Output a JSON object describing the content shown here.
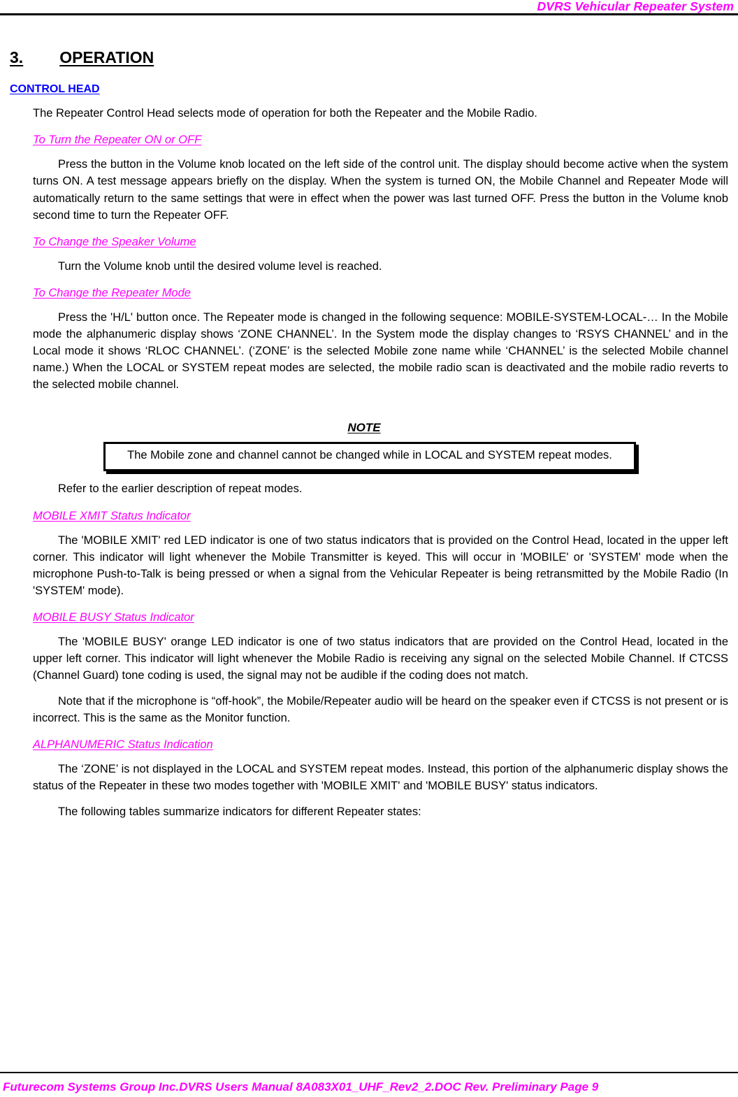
{
  "document": {
    "header_title": "DVRS Vehicular Repeater System",
    "footer_text": "Futurecom Systems Group Inc.DVRS Users Manual 8A083X01_UHF_Rev2_2.DOC Rev. Preliminary  Page 9",
    "colors": {
      "accent_magenta": "#FF00FF",
      "heading_blue": "#0000FF",
      "text_black": "#000000",
      "page_background": "#FFFFFF"
    }
  },
  "section": {
    "number": "3.",
    "title": "OPERATION"
  },
  "control_head": {
    "heading": "CONTROL HEAD",
    "intro": "The Repeater Control Head selects mode of operation for both the Repeater and the Mobile Radio.",
    "subsections": [
      {
        "heading": "To Turn the Repeater ON or OFF",
        "body": "Press the button in the Volume knob located on the left side of the control unit. The display should become active when the system turns ON. A test message appears briefly on the display. When the system is turned ON, the Mobile Channel and Repeater Mode will automatically return to the same settings that were in effect when the power was last turned OFF. Press the button in the Volume knob second time to turn the Repeater OFF."
      },
      {
        "heading": "To Change the Speaker Volume",
        "body": "Turn the Volume knob until the desired volume level is reached."
      },
      {
        "heading": "To Change the Repeater Mode",
        "body": "Press the 'H/L' button once. The Repeater mode is changed in the following sequence: MOBILE-SYSTEM-LOCAL-… In the Mobile mode the alphanumeric display shows ‘ZONE CHANNEL’. In the System mode the display changes to ‘RSYS CHANNEL’ and in the Local mode it shows ‘RLOC CHANNEL’. (‘ZONE’ is the selected Mobile zone name while ‘CHANNEL’ is the selected Mobile channel name.) When the LOCAL or SYSTEM repeat modes are selected, the mobile radio scan is deactivated and the mobile radio reverts to the selected mobile channel."
      }
    ]
  },
  "note": {
    "label": "NOTE",
    "text": "The Mobile zone and channel cannot be changed while in LOCAL and SYSTEM repeat modes."
  },
  "after_note": {
    "refer_text": "Refer to the earlier description of repeat modes."
  },
  "indicators": [
    {
      "heading": "MOBILE XMIT Status Indicator",
      "paragraphs": [
        "The 'MOBILE XMIT' red LED indicator is one of two status indicators that is provided on the Control Head, located in the upper left corner. This indicator will light whenever the Mobile Transmitter is keyed. This will occur in 'MOBILE' or 'SYSTEM' mode when the microphone Push-to-Talk is being pressed or when a signal from the Vehicular Repeater is being retransmitted by the Mobile Radio (In 'SYSTEM' mode)."
      ]
    },
    {
      "heading": "MOBILE BUSY Status Indicator",
      "paragraphs": [
        "The 'MOBILE BUSY' orange LED indicator is one of two status indicators that are provided on the Control Head, located in the upper left corner. This indicator will light whenever the Mobile Radio is receiving any signal on the selected Mobile Channel. If CTCSS (Channel Guard) tone coding is used, the signal may not be audible if the coding does not match.",
        "Note that if the microphone is “off-hook”, the Mobile/Repeater audio will be heard on the speaker even if CTCSS is not present or is incorrect. This is the same as the Monitor function."
      ]
    },
    {
      "heading": "ALPHANUMERIC Status Indication",
      "paragraphs": [
        "The ‘ZONE’ is not displayed in the LOCAL and SYSTEM repeat modes. Instead, this portion of the alphanumeric display shows the status of the Repeater in these two modes together with 'MOBILE XMIT' and 'MOBILE BUSY' status indicators.",
        "The following tables summarize indicators for different Repeater states:"
      ]
    }
  ]
}
